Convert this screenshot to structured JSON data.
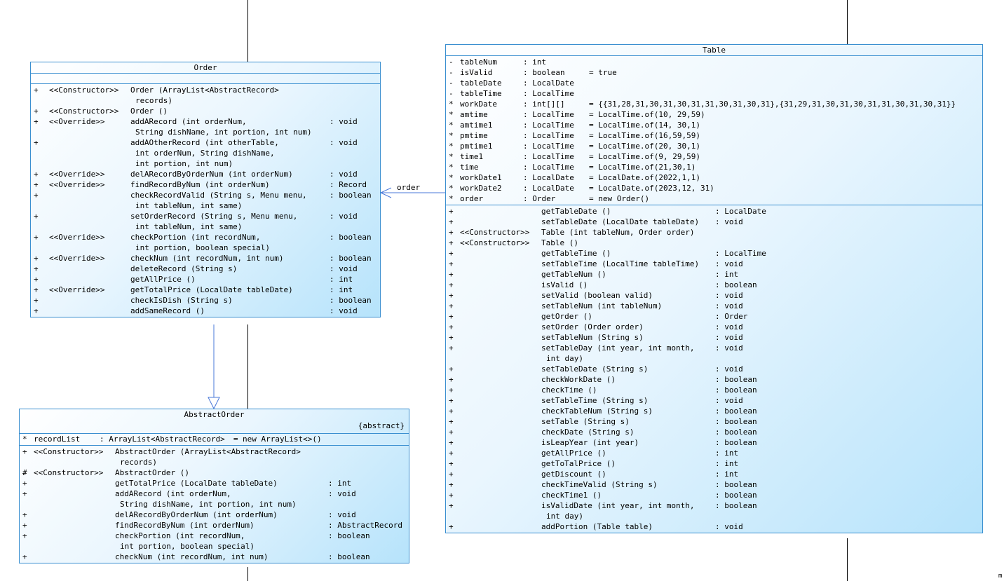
{
  "diagram": {
    "association_label": "order",
    "corner_mark": "m",
    "order": {
      "name": "Order",
      "operations": [
        {
          "vis": "+",
          "stereo": "<<Constructor>>",
          "name": "Order (ArrayList<AbstractRecord>",
          "cont": "records)",
          "type": ""
        },
        {
          "vis": "+",
          "stereo": "<<Constructor>>",
          "name": "Order ()",
          "type": ""
        },
        {
          "vis": "+",
          "stereo": "<<Override>>",
          "name": "addARecord (int orderNum,",
          "cont": "String dishName, int portion, int num)",
          "type": ": void"
        },
        {
          "vis": "+",
          "stereo": "",
          "name": "addAOtherRecord (int otherTable,",
          "cont": "int orderNum, String dishName,",
          "cont2": "int portion, int num)",
          "type": ": void"
        },
        {
          "vis": "+",
          "stereo": "<<Override>>",
          "name": "delARecordByOrderNum (int orderNum)",
          "type": ": void"
        },
        {
          "vis": "+",
          "stereo": "<<Override>>",
          "name": "findRecordByNum (int orderNum)",
          "type": ": Record"
        },
        {
          "vis": "+",
          "stereo": "",
          "name": "checkRecordValid (String s, Menu menu,",
          "cont": "int tableNum, int same)",
          "type": ": boolean"
        },
        {
          "vis": "+",
          "stereo": "",
          "name": "setOrderRecord (String s, Menu menu,",
          "cont": "int tableNum, int same)",
          "type": ": void"
        },
        {
          "vis": "+",
          "stereo": "<<Override>>",
          "name": "checkPortion (int recordNum,",
          "cont": "int portion, boolean special)",
          "type": ": boolean"
        },
        {
          "vis": "+",
          "stereo": "<<Override>>",
          "name": "checkNum (int recordNum, int num)",
          "type": ": boolean"
        },
        {
          "vis": "+",
          "stereo": "",
          "name": "deleteRecord (String s)",
          "type": ": void"
        },
        {
          "vis": "+",
          "stereo": "",
          "name": "getAllPrice ()",
          "type": ": int"
        },
        {
          "vis": "+",
          "stereo": "<<Override>>",
          "name": "getTotalPrice (LocalDate tableDate)",
          "type": ": int"
        },
        {
          "vis": "+",
          "stereo": "",
          "name": "checkIsDish (String s)",
          "type": ": boolean"
        },
        {
          "vis": "+",
          "stereo": "",
          "name": "addSameRecord ()",
          "type": ": void"
        }
      ]
    },
    "abstract_order": {
      "name": "AbstractOrder",
      "stereotype": "{abstract}",
      "attributes": [
        {
          "vis": "*",
          "name": "recordList",
          "type": ": ArrayList<AbstractRecord>",
          "init": "= new ArrayList<>()"
        }
      ],
      "operations": [
        {
          "vis": "+",
          "stereo": "<<Constructor>>",
          "name": "AbstractOrder (ArrayList<AbstractRecord>",
          "cont": "records)",
          "type": ""
        },
        {
          "vis": "#",
          "stereo": "<<Constructor>>",
          "name": "AbstractOrder ()",
          "type": ""
        },
        {
          "vis": "+",
          "stereo": "",
          "name": "getTotalPrice (LocalDate tableDate)",
          "type": ": int"
        },
        {
          "vis": "+",
          "stereo": "",
          "name": "addARecord (int orderNum,",
          "cont": "String dishName, int portion, int num)",
          "type": ": void"
        },
        {
          "vis": "+",
          "stereo": "",
          "name": "delARecordByOrderNum (int orderNum)",
          "type": ": void"
        },
        {
          "vis": "+",
          "stereo": "",
          "name": "findRecordByNum (int orderNum)",
          "type": ": AbstractRecord"
        },
        {
          "vis": "+",
          "stereo": "",
          "name": "checkPortion (int recordNum,",
          "cont": "int portion, boolean special)",
          "type": ": boolean"
        },
        {
          "vis": "+",
          "stereo": "",
          "name": "checkNum (int recordNum, int num)",
          "type": ": boolean"
        }
      ]
    },
    "table": {
      "name": "Table",
      "attributes": [
        {
          "vis": "-",
          "name": "tableNum",
          "type": ": int",
          "init": ""
        },
        {
          "vis": "-",
          "name": "isValid",
          "type": ": boolean",
          "init": "= true"
        },
        {
          "vis": "-",
          "name": "tableDate",
          "type": ": LocalDate",
          "init": ""
        },
        {
          "vis": "-",
          "name": "tableTime",
          "type": ": LocalTime",
          "init": ""
        },
        {
          "vis": "*",
          "name": "workDate",
          "type": ": int[][]",
          "init": "= {{31,28,31,30,31,30,31,31,30,31,30,31},{31,29,31,30,31,30,31,31,30,31,30,31}}"
        },
        {
          "vis": "*",
          "name": "amtime",
          "type": ": LocalTime",
          "init": "= LocalTime.of(10, 29,59)"
        },
        {
          "vis": "*",
          "name": "amtime1",
          "type": ": LocalTime",
          "init": "= LocalTime.of(14, 30,1)"
        },
        {
          "vis": "*",
          "name": "pmtime",
          "type": ": LocalTime",
          "init": "= LocalTime.of(16,59,59)"
        },
        {
          "vis": "*",
          "name": "pmtime1",
          "type": ": LocalTime",
          "init": "= LocalTime.of(20, 30,1)"
        },
        {
          "vis": "*",
          "name": "time1",
          "type": ": LocalTime",
          "init": "= LocalTime.of(9, 29,59)"
        },
        {
          "vis": "*",
          "name": "time",
          "type": ": LocalTime",
          "init": "= LocalTime.of(21,30,1)"
        },
        {
          "vis": "*",
          "name": "workDate1",
          "type": ": LocalDate",
          "init": "= LocalDate.of(2022,1,1)"
        },
        {
          "vis": "*",
          "name": "workDate2",
          "type": ": LocalDate",
          "init": "= LocalDate.of(2023,12, 31)"
        },
        {
          "vis": "*",
          "name": "order",
          "type": ": Order",
          "init": "= new Order()"
        }
      ],
      "operations": [
        {
          "vis": "+",
          "stereo": "",
          "name": "getTableDate ()",
          "type": ": LocalDate"
        },
        {
          "vis": "+",
          "stereo": "",
          "name": "setTableDate (LocalDate tableDate)",
          "type": ": void"
        },
        {
          "vis": "+",
          "stereo": "<<Constructor>>",
          "name": "Table (int tableNum, Order order)",
          "type": ""
        },
        {
          "vis": "+",
          "stereo": "<<Constructor>>",
          "name": "Table ()",
          "type": ""
        },
        {
          "vis": "+",
          "stereo": "",
          "name": "getTableTime ()",
          "type": ": LocalTime"
        },
        {
          "vis": "+",
          "stereo": "",
          "name": "setTableTime (LocalTime tableTime)",
          "type": ": void"
        },
        {
          "vis": "+",
          "stereo": "",
          "name": "getTableNum ()",
          "type": ": int"
        },
        {
          "vis": "+",
          "stereo": "",
          "name": "isValid ()",
          "type": ": boolean"
        },
        {
          "vis": "+",
          "stereo": "",
          "name": "setValid (boolean valid)",
          "type": ": void"
        },
        {
          "vis": "+",
          "stereo": "",
          "name": "setTableNum (int tableNum)",
          "type": ": void"
        },
        {
          "vis": "+",
          "stereo": "",
          "name": "getOrder ()",
          "type": ": Order"
        },
        {
          "vis": "+",
          "stereo": "",
          "name": "setOrder (Order order)",
          "type": ": void"
        },
        {
          "vis": "+",
          "stereo": "",
          "name": "setTableNum (String s)",
          "type": ": void"
        },
        {
          "vis": "+",
          "stereo": "",
          "name": "setTableDay (int year, int month,",
          "cont": "int day)",
          "type": ": void"
        },
        {
          "vis": "+",
          "stereo": "",
          "name": "setTableDate (String s)",
          "type": ": void"
        },
        {
          "vis": "+",
          "stereo": "",
          "name": "checkWorkDate ()",
          "type": ": boolean"
        },
        {
          "vis": "+",
          "stereo": "",
          "name": "checkTime ()",
          "type": ": boolean"
        },
        {
          "vis": "+",
          "stereo": "",
          "name": "setTableTime (String s)",
          "type": ": void"
        },
        {
          "vis": "+",
          "stereo": "",
          "name": "checkTableNum (String s)",
          "type": ": boolean"
        },
        {
          "vis": "+",
          "stereo": "",
          "name": "setTable (String s)",
          "type": ": boolean"
        },
        {
          "vis": "+",
          "stereo": "",
          "name": "checkDate (String s)",
          "type": ": boolean"
        },
        {
          "vis": "+",
          "stereo": "",
          "name": "isLeapYear (int year)",
          "type": ": boolean"
        },
        {
          "vis": "+",
          "stereo": "",
          "name": "getAllPrice ()",
          "type": ": int"
        },
        {
          "vis": "+",
          "stereo": "",
          "name": "getToTalPrice ()",
          "type": ": int"
        },
        {
          "vis": "+",
          "stereo": "",
          "name": "getDiscount ()",
          "type": ": int"
        },
        {
          "vis": "+",
          "stereo": "",
          "name": "checkTimeValid (String s)",
          "type": ": boolean"
        },
        {
          "vis": "+",
          "stereo": "",
          "name": "checkTime1 ()",
          "type": ": boolean"
        },
        {
          "vis": "+",
          "stereo": "",
          "name": "isValidDate (int year, int month,",
          "cont": "int day)",
          "type": ": boolean"
        },
        {
          "vis": "+",
          "stereo": "",
          "name": "addPortion (Table table)",
          "type": ": void"
        }
      ]
    }
  }
}
